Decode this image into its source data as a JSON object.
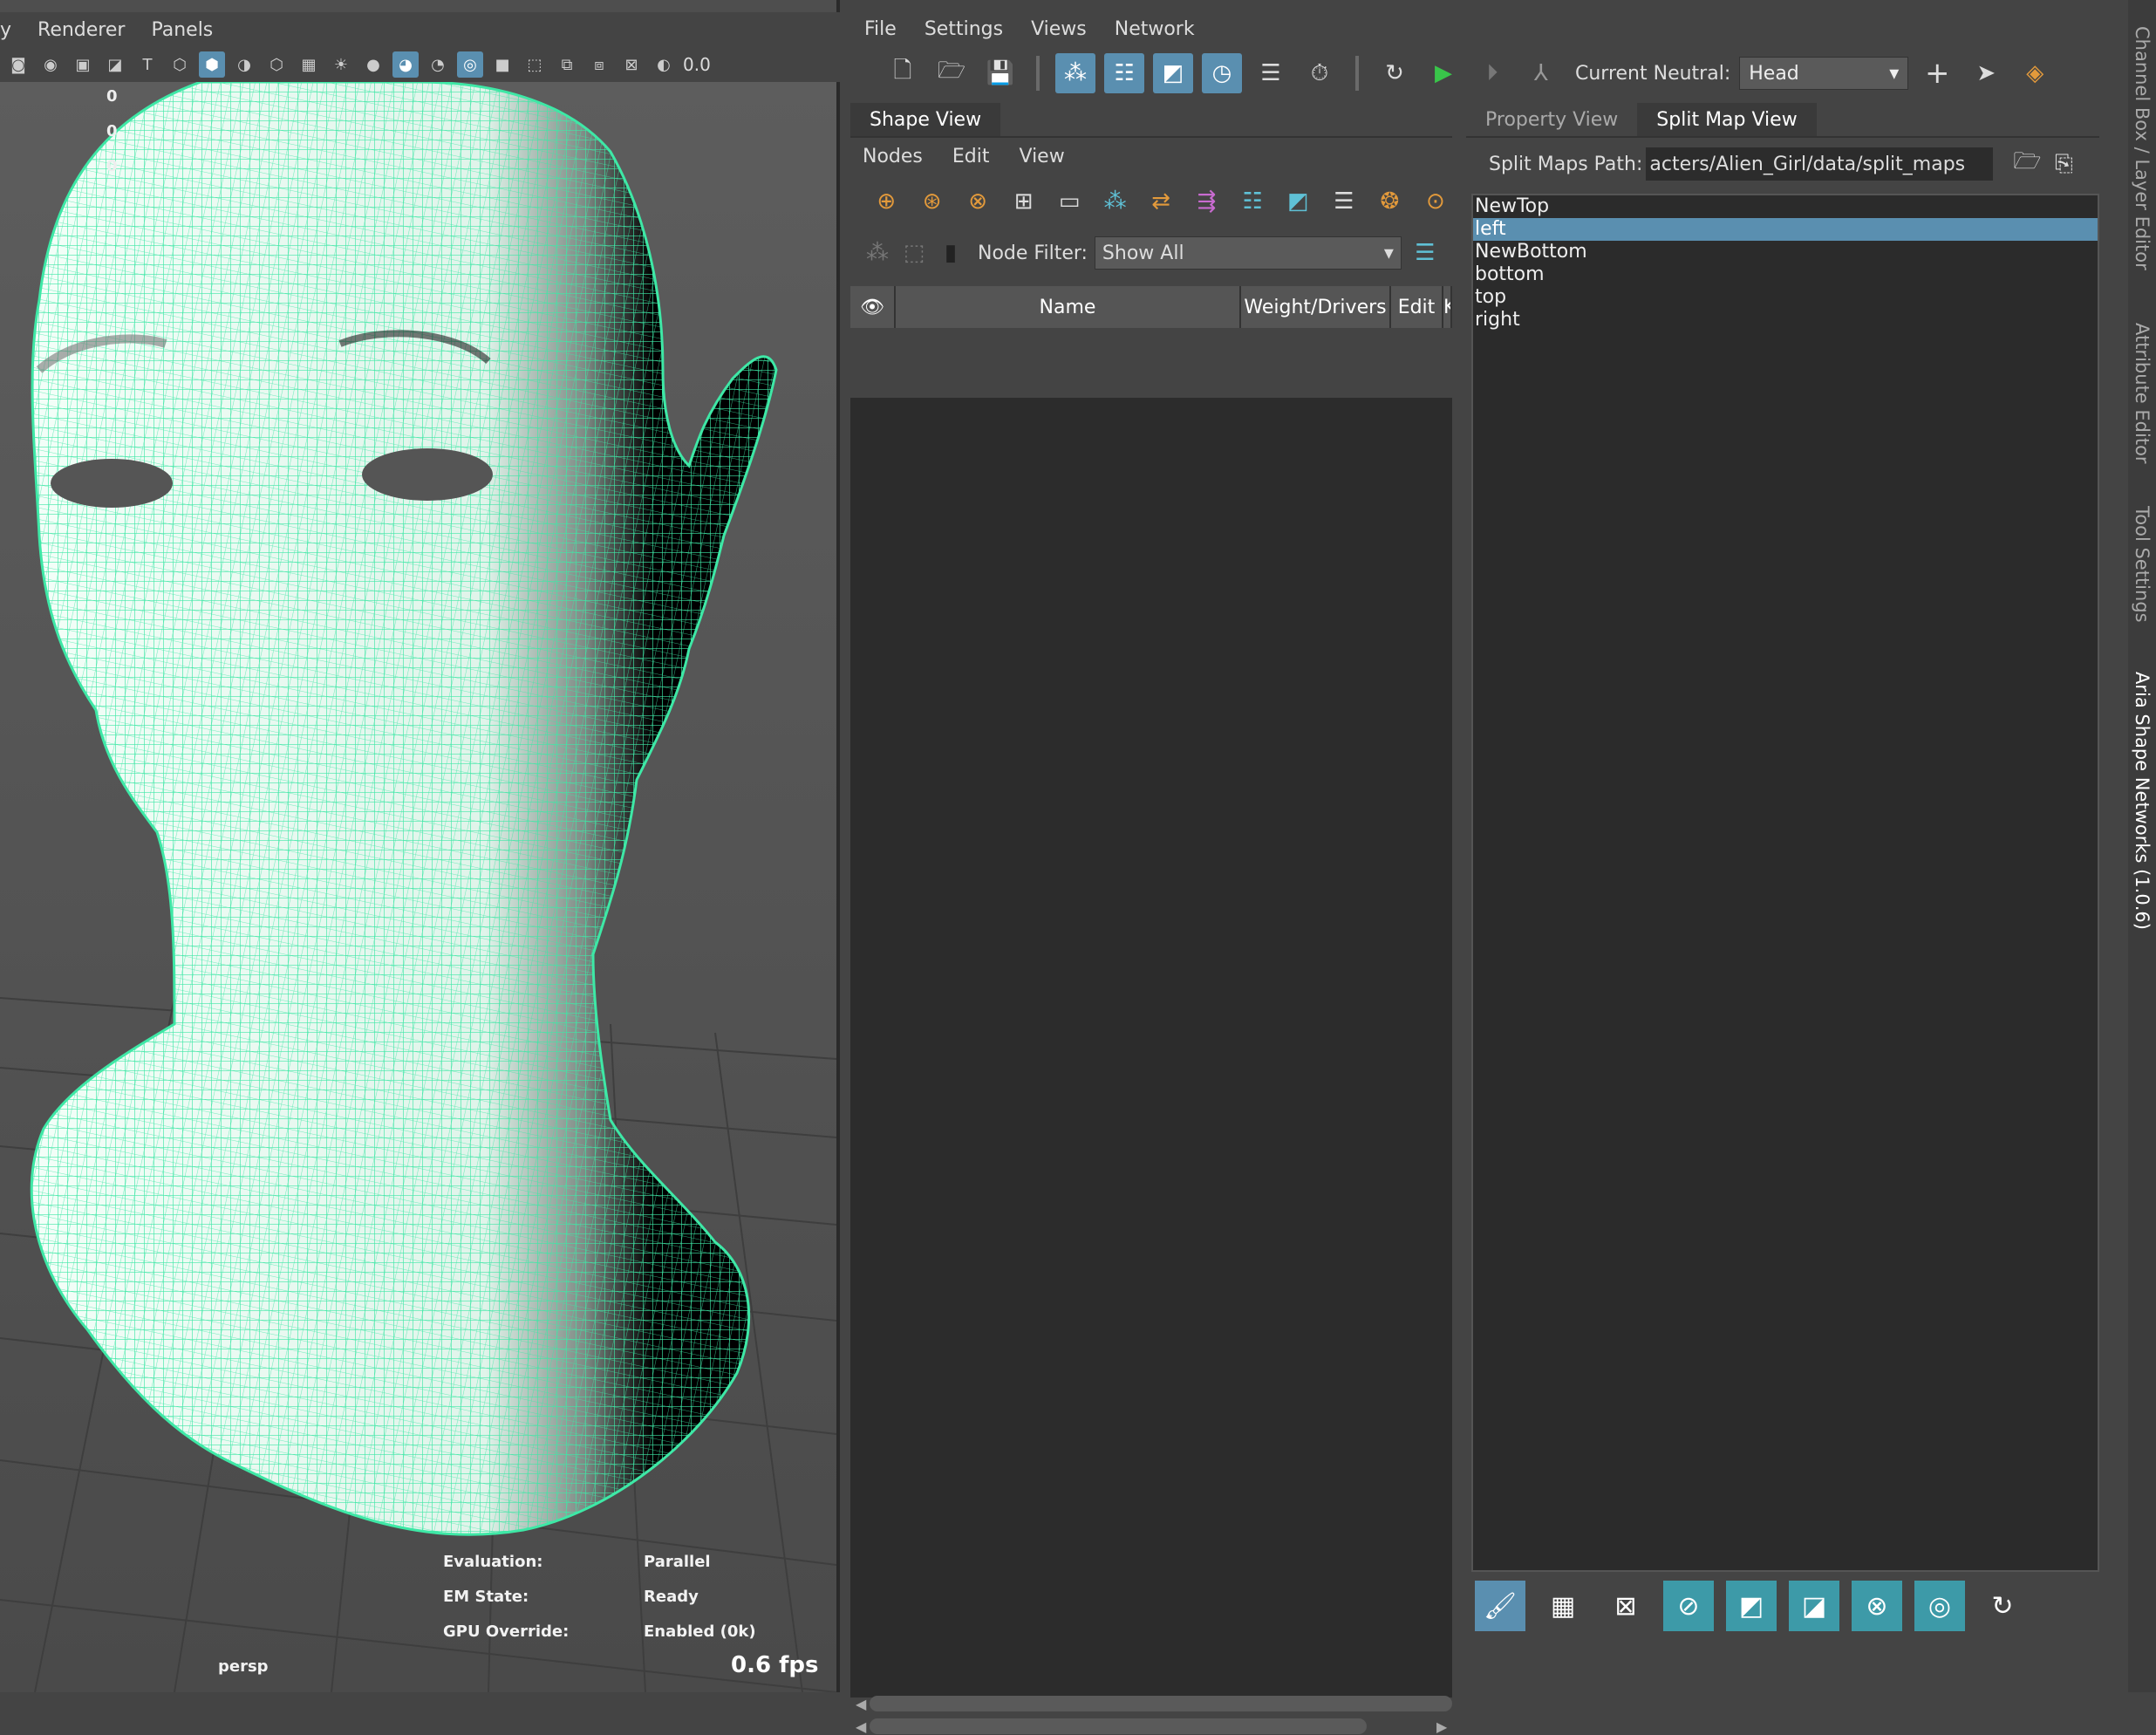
{
  "viewport": {
    "menu": [
      "y",
      "Renderer",
      "Panels"
    ],
    "toolbar_value": "0.0",
    "hud_values": [
      "0",
      "0",
      "0"
    ],
    "camera": "persp",
    "fps": "0.6 fps",
    "status": [
      {
        "label": "Evaluation:",
        "value": "Parallel"
      },
      {
        "label": "EM State:",
        "value": "Ready"
      },
      {
        "label": "GPU Override:",
        "value": "Enabled (0k)"
      }
    ]
  },
  "main_menu": [
    "File",
    "Settings",
    "Views",
    "Network"
  ],
  "toolbar": {
    "neutral_label": "Current Neutral:",
    "neutral_value": "Head"
  },
  "shape_view": {
    "tab": "Shape View",
    "menu": [
      "Nodes",
      "Edit",
      "View"
    ],
    "filter_label": "Node Filter:",
    "filter_value": "Show All",
    "columns": [
      "Name",
      "Weight/Drivers",
      "Edit",
      "Key"
    ]
  },
  "split_view": {
    "tabs": [
      "Property View",
      "Split Map View"
    ],
    "path_label": "Split Maps Path:",
    "path_value": "acters/Alien_Girl/data/split_maps",
    "maps": [
      "NewTop",
      "left",
      "NewBottom",
      "bottom",
      "top",
      "right"
    ],
    "selected_index": 1
  },
  "dock_tabs": [
    "Channel Box / Layer Editor",
    "Attribute Editor",
    "Tool Settings",
    "Aria Shape Networks (1.0.6)"
  ],
  "colors": {
    "accent": "#5a8fb0",
    "wire": "#3ee8a6",
    "teal_button": "#3d9aa8"
  }
}
